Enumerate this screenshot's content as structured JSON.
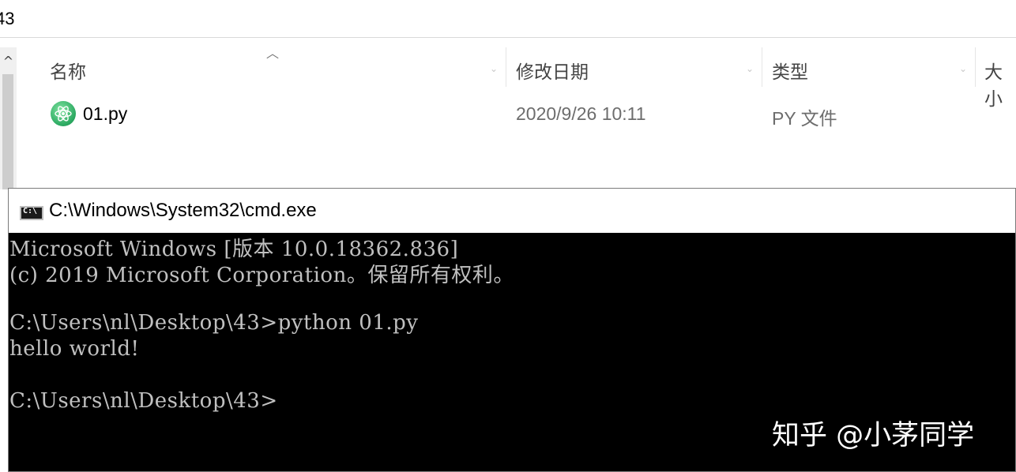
{
  "explorer": {
    "address": "43",
    "columns": [
      {
        "label": "名称"
      },
      {
        "label": "修改日期"
      },
      {
        "label": "类型"
      },
      {
        "label": "大小"
      }
    ],
    "files": [
      {
        "name": "01.py",
        "modified": "2020/9/26 10:11",
        "type": "PY 文件"
      }
    ]
  },
  "cmd": {
    "icon_text": "C:\\",
    "title": "C:\\Windows\\System32\\cmd.exe",
    "lines": [
      "Microsoft Windows [版本 10.0.18362.836]",
      "(c) 2019 Microsoft Corporation。保留所有权利。",
      "",
      "C:\\Users\\nl\\Desktop\\43>python 01.py",
      "hello world!",
      "",
      "C:\\Users\\nl\\Desktop\\43>"
    ]
  },
  "watermark": "知乎 @小茅同学",
  "colors": {
    "console_bg": "#000000",
    "console_text": "#c0c0c0",
    "file_icon": "#2aa860"
  },
  "icons": {
    "file": "python-file-icon",
    "sort": "sort-up-icon",
    "cmd": "cmd-icon"
  }
}
